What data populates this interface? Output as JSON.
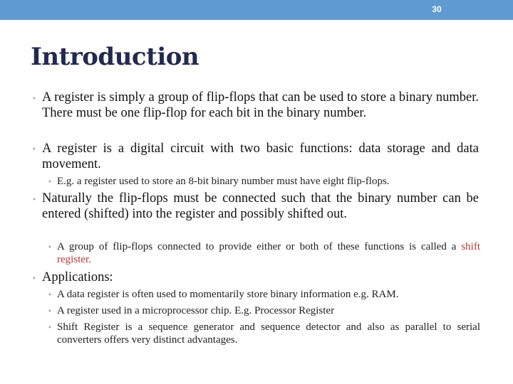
{
  "header": {
    "slide_number": "30",
    "bar_color": "#5f9bd0"
  },
  "title": "Introduction",
  "bullets": [
    {
      "text": "A register is simply a group of flip-flops that can be used to store a binary number. There must be one flip-flop for each bit in the binary number."
    },
    {
      "text": "A register is a digital circuit with two basic functions: data storage and data movement.",
      "sub": [
        {
          "text": "E.g. a register used to store an 8-bit binary number must have eight flip-flops."
        }
      ]
    },
    {
      "text": "Naturally the flip-flops must be connected such that the binary number can be entered (shifted) into the register and possibly shifted out.",
      "sub": [
        {
          "text_before": "A group of flip-flops connected to provide either or both of these functions is called a ",
          "highlight": "shift register.",
          "highlight_color": "#b03a3a"
        }
      ]
    },
    {
      "text": "Applications:",
      "sub": [
        {
          "text": "A data register is often used to momentarily store binary information e.g. RAM."
        },
        {
          "text": "A register used in a microprocessor chip. E.g. Processor Register"
        },
        {
          "text": "Shift Register is a sequence generator and sequence detector and also as parallel to serial converters offers very distinct advantages."
        }
      ]
    }
  ]
}
